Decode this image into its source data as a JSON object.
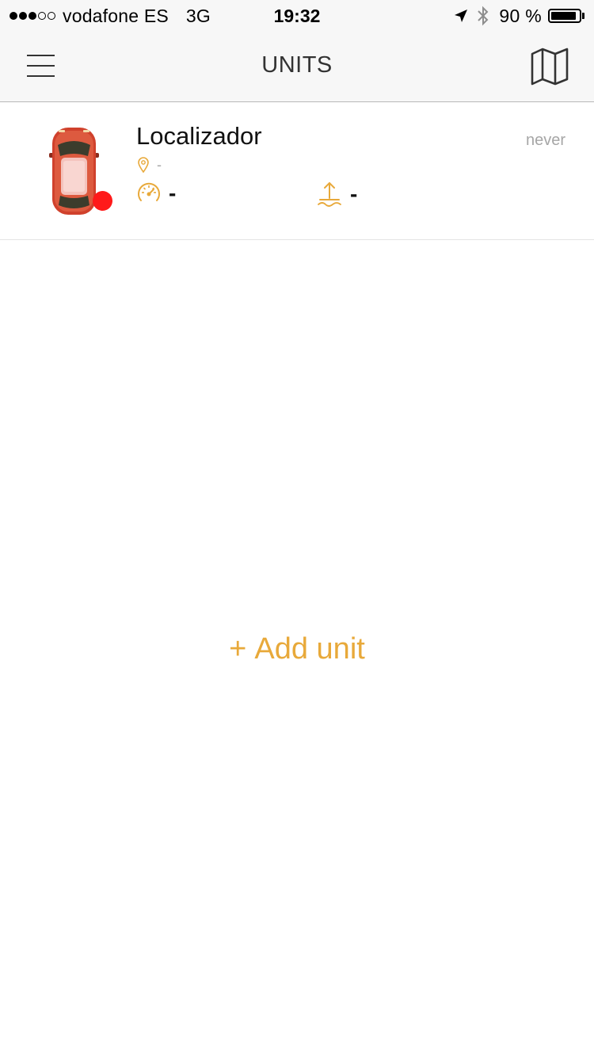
{
  "status_bar": {
    "signal_bars_filled": 3,
    "signal_bars_total": 5,
    "carrier": "vodafone ES",
    "network": "3G",
    "time": "19:32",
    "battery_percent": "90 %",
    "battery_level": 0.9
  },
  "nav": {
    "title": "UNITS",
    "menu_icon": "hamburger-menu-icon",
    "map_icon": "map-icon"
  },
  "units": [
    {
      "name": "Localizador",
      "last_update": "never",
      "address": "-",
      "speed": "-",
      "altitude": "-",
      "icon": "car-top-view-icon",
      "status_color": "#ff1a1a"
    }
  ],
  "add_unit": {
    "plus": "+",
    "label": "Add unit"
  },
  "colors": {
    "accent": "#e8a93a",
    "status_red": "#ff1a1a",
    "car_body": "#d0412c",
    "bar_bg": "#f7f7f7",
    "muted_text": "#a6a6a6"
  }
}
